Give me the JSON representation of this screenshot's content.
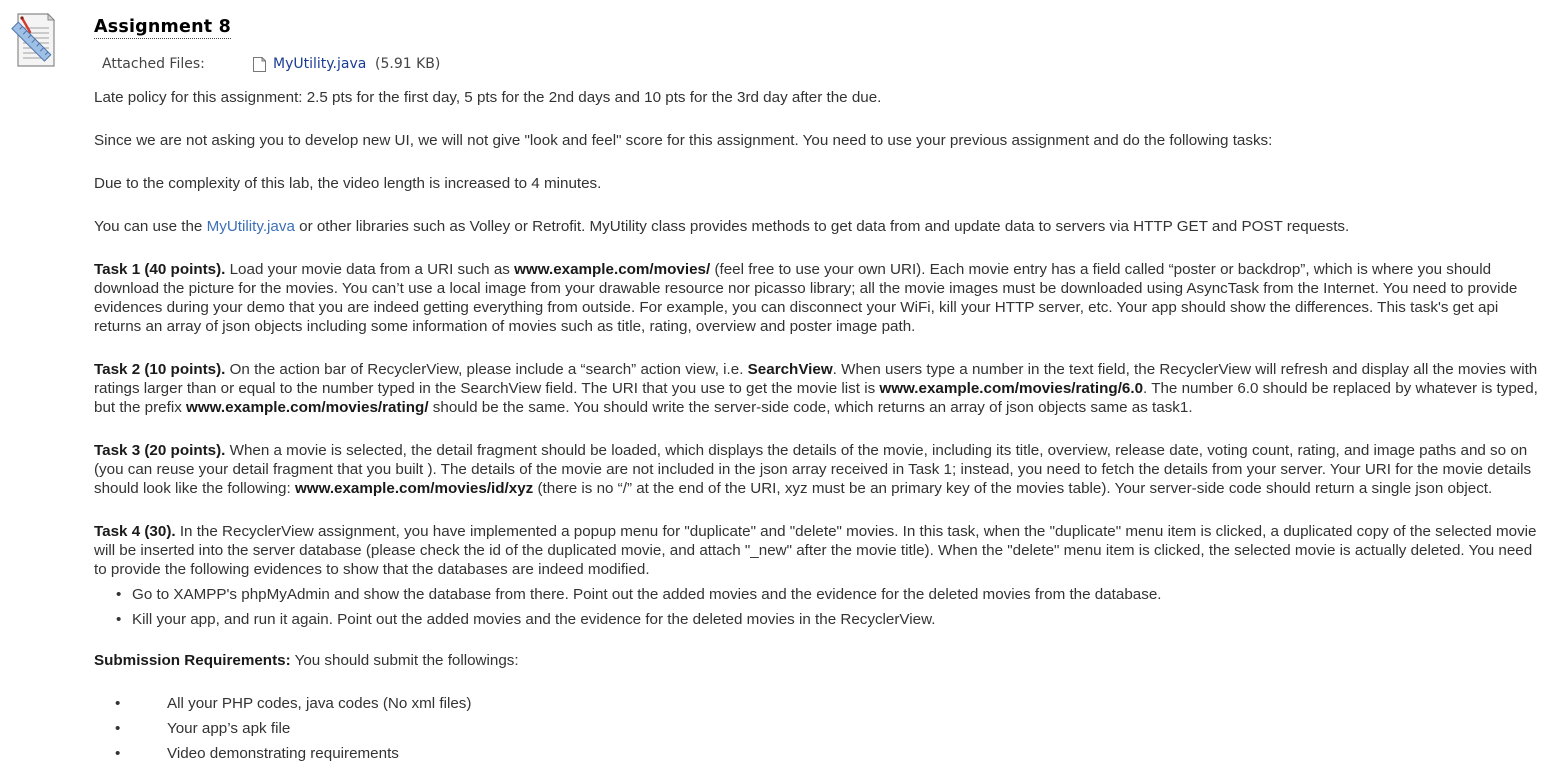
{
  "assignment": {
    "title": "Assignment 8",
    "attached_label": "Attached Files:",
    "attached_file": "MyUtility.java",
    "attached_size": "(5.91 KB)"
  },
  "content": {
    "late_policy": "Late policy for this assignment: 2.5 pts for the first day, 5 pts for the 2nd days and 10 pts for the 3rd day after the due.",
    "ui_note": "Since we are not asking you to develop new UI, we will not give \"look and feel\" score for this assignment. You need to use your previous assignment and do the following tasks:",
    "video_note": "Due to the complexity of this lab, the video length is increased to 4 minutes.",
    "libs": {
      "before": "You can use the ",
      "link": "MyUtility.java",
      "after": " or other libraries such as Volley or Retrofit. MyUtility class provides methods to get data from and update data to servers via HTTP GET and POST requests."
    },
    "task1": {
      "label": "Task 1 (40 points).",
      "t1": " Load your movie data from a URI such as ",
      "uri": "www.example.com/movies/",
      "t2": " (feel free to use your own URI). Each movie entry has a field called “poster or backdrop”, which is where you should download the picture for the movies. You can’t use a local image from your drawable resource nor picasso library; all the movie images must be downloaded using AsyncTask from the Internet. You need to provide evidences during your demo that you are indeed getting everything from outside. For example, you can disconnect your WiFi, kill your HTTP server, etc. Your app should show the differences. This task's get api returns an array of json objects including some information of movies such as title, rating, overview and poster image path."
    },
    "task2": {
      "label": "Task 2 (10 points).",
      "t1": " On the action bar of RecyclerView, please include a “search” action view, i.e. ",
      "sv": "SearchView",
      "t2": ". When users type a number in the text field, the RecyclerView will refresh and display all the movies with ratings larger than or equal to the number typed in the SearchView field. The URI that you use to get the movie list is ",
      "uri": "www.example.com/movies/rating/6.0",
      "t3": ".  The number 6.0 should be replaced by whatever is typed, but the prefix ",
      "prefix": "www.example.com/movies/rating/",
      "t4": " should be the same. You should write the server-side code, which returns an array of json objects same as task1."
    },
    "task3": {
      "label": "Task 3 (20 points).",
      "t1": " When a movie is selected, the detail fragment should be loaded, which displays the details of the movie, including its title, overview, release date, voting count, rating, and image paths and so on (you can reuse your detail fragment that you built ). The details of the movie are not included in the json array received in Task 1; instead, you need to fetch the details from your server. Your URI for the movie details should look like the following: ",
      "uri": "www.example.com/movies/id/xyz",
      "t2": " (there is no “/” at the end of the URI, xyz must be an primary key of the movies table). Your server-side code should return a single json object."
    },
    "task4": {
      "label": "Task 4 (30).",
      "t1": " In the RecyclerView assignment, you have implemented a popup menu for \"duplicate\" and \"delete\" movies. In this task, when the \"duplicate\" menu item is clicked, a duplicated copy of the selected movie will be inserted into the server database (please check the id of the duplicated movie, and attach \"_new\" after the movie title). When the \"delete\" menu item is clicked, the selected movie is actually deleted. You need to provide the following evidences to show that the databases are indeed modified.",
      "bullets": [
        "Go to XAMPP's phpMyAdmin and show the database from there. Point out the added movies and the evidence for the deleted movies from the database.",
        "Kill your app, and run it again. Point out the added movies and the evidence for the deleted movies in the RecyclerView."
      ]
    },
    "submission": {
      "label": "Submission Requirements:",
      "text": " You should submit the followings:",
      "items": [
        "All your PHP codes, java codes (No xml files)",
        "Your app’s apk file",
        "Video demonstrating requirements"
      ]
    }
  }
}
